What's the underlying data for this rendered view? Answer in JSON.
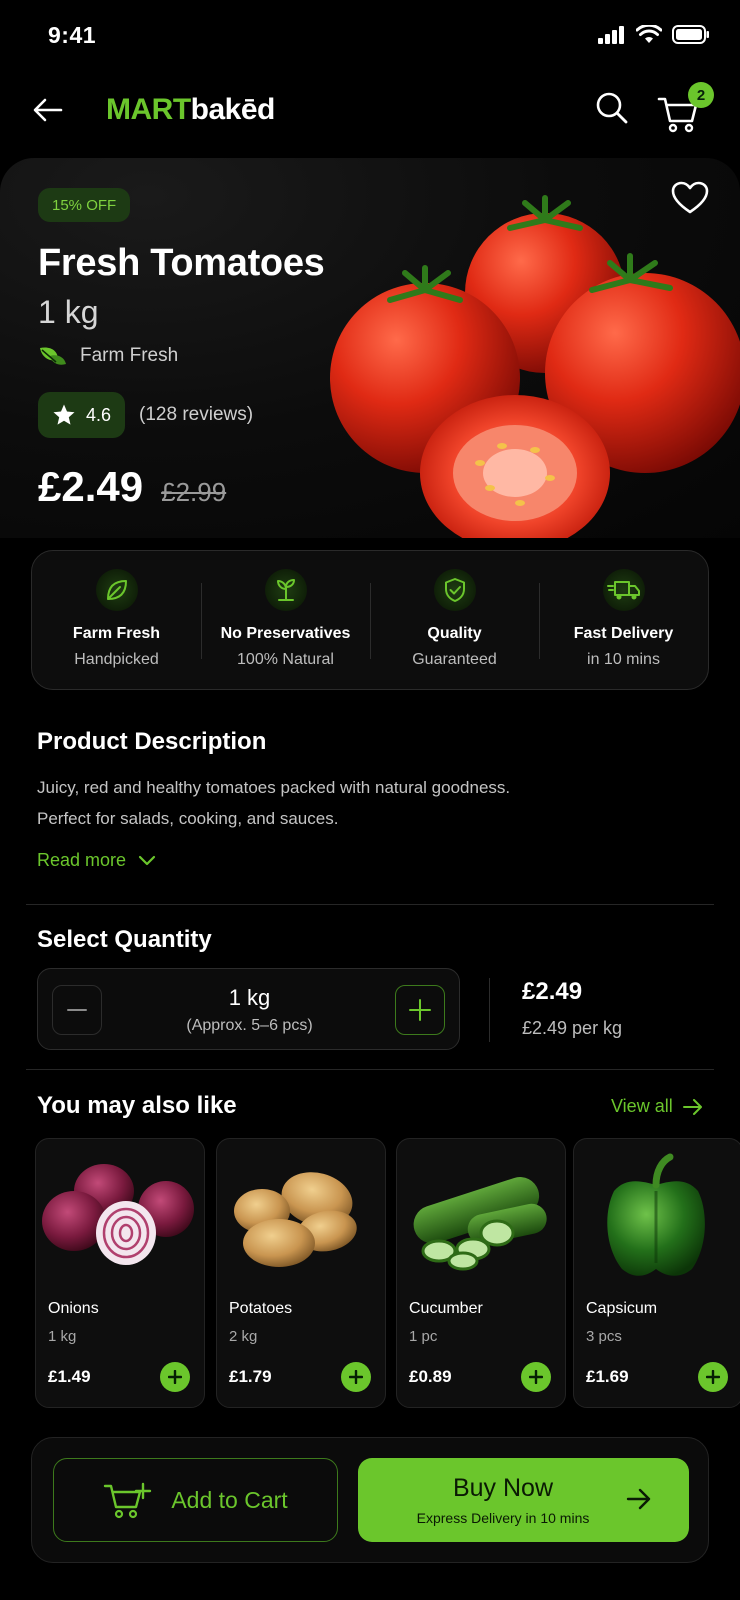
{
  "status_bar": {
    "time": "9:41"
  },
  "header": {
    "logo_primary": "MART",
    "logo_secondary": "bakēd",
    "cart_count": "2"
  },
  "product": {
    "discount": "15% OFF",
    "name": "Fresh Tomatoes",
    "size": "1 kg",
    "tag": "Farm Fresh",
    "rating": "4.6",
    "reviews": "(128 reviews)",
    "price": "£2.49",
    "old_price": "£2.99"
  },
  "features": [
    {
      "title": "Farm Fresh",
      "subtitle": "Handpicked",
      "icon": "leaf-icon"
    },
    {
      "title": "No Preservatives",
      "subtitle": "100% Natural",
      "icon": "sprout-icon"
    },
    {
      "title": "Quality",
      "subtitle": "Guaranteed",
      "icon": "shield-check-icon"
    },
    {
      "title": "Fast Delivery",
      "subtitle": "in 10 mins",
      "icon": "truck-icon"
    }
  ],
  "description": {
    "title": "Product Description",
    "line1": "Juicy, red and healthy tomatoes packed with natural goodness.",
    "line2": "Perfect for salads, cooking, and sauces.",
    "read_more": "Read more"
  },
  "quantity": {
    "title": "Select Quantity",
    "value": "1 kg",
    "approx": "(Approx. 5–6 pcs)",
    "total": "£2.49",
    "unit_price": "£2.49 per kg"
  },
  "recommendations": {
    "title": "You may also like",
    "view_all": "View all",
    "items": [
      {
        "name": "Onions",
        "qty": "1 kg",
        "price": "£1.49"
      },
      {
        "name": "Potatoes",
        "qty": "2 kg",
        "price": "£1.79"
      },
      {
        "name": "Cucumber",
        "qty": "1 pc",
        "price": "£0.89"
      },
      {
        "name": "Capsicum",
        "qty": "3 pcs",
        "price": "£1.69"
      }
    ]
  },
  "actions": {
    "add_to_cart": "Add to Cart",
    "buy_now": "Buy Now",
    "buy_now_sub": "Express Delivery in 10 mins"
  },
  "colors": {
    "accent": "#6bc62c",
    "background": "#000000",
    "badge_bg": "#1d3a14"
  }
}
